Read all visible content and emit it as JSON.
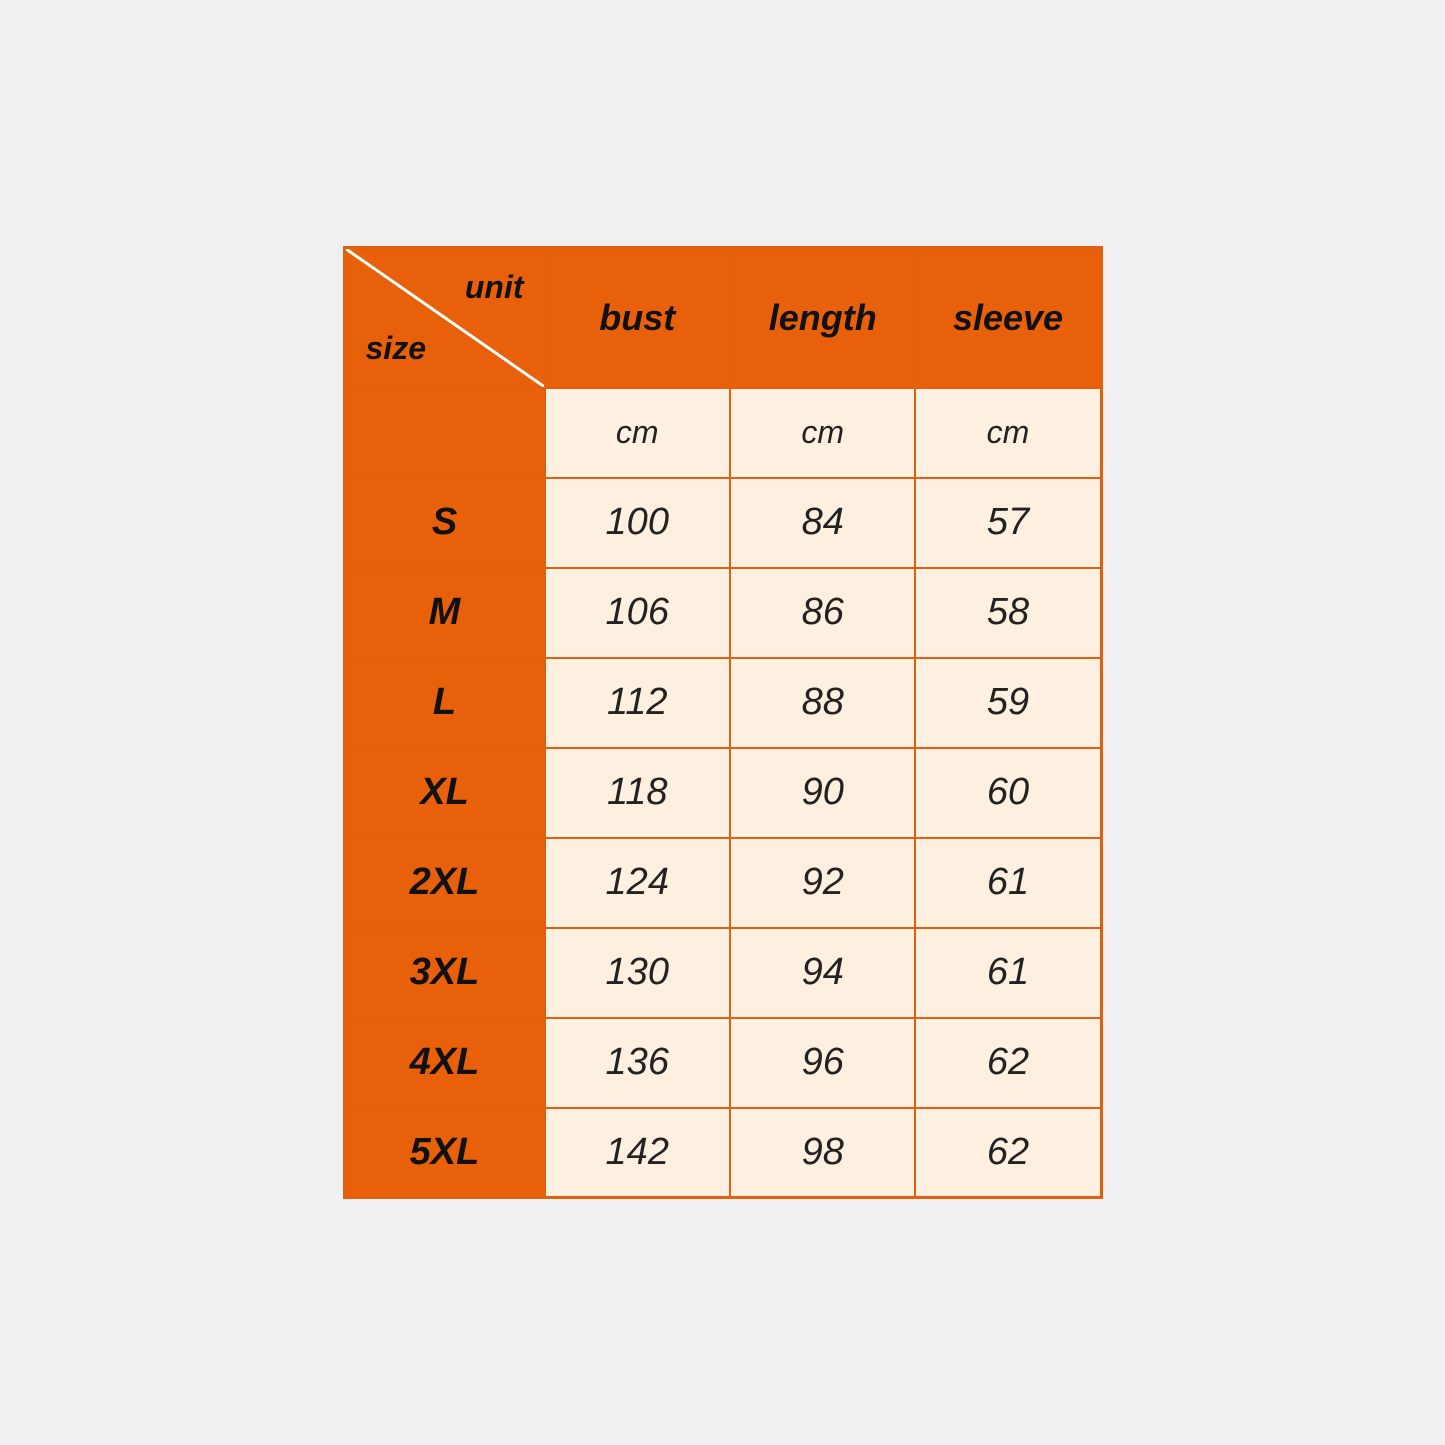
{
  "table": {
    "corner": {
      "unit_label": "unit",
      "size_label": "size"
    },
    "columns": [
      {
        "id": "bust",
        "label": "bust",
        "unit": "cm"
      },
      {
        "id": "length",
        "label": "length",
        "unit": "cm"
      },
      {
        "id": "sleeve",
        "label": "sleeve",
        "unit": "cm"
      }
    ],
    "rows": [
      {
        "size": "S",
        "bust": "100",
        "length": "84",
        "sleeve": "57"
      },
      {
        "size": "M",
        "bust": "106",
        "length": "86",
        "sleeve": "58"
      },
      {
        "size": "L",
        "bust": "112",
        "length": "88",
        "sleeve": "59"
      },
      {
        "size": "XL",
        "bust": "118",
        "length": "90",
        "sleeve": "60"
      },
      {
        "size": "2XL",
        "bust": "124",
        "length": "92",
        "sleeve": "61"
      },
      {
        "size": "3XL",
        "bust": "130",
        "length": "94",
        "sleeve": "61"
      },
      {
        "size": "4XL",
        "bust": "136",
        "length": "96",
        "sleeve": "62"
      },
      {
        "size": "5XL",
        "bust": "142",
        "length": "98",
        "sleeve": "62"
      }
    ]
  }
}
